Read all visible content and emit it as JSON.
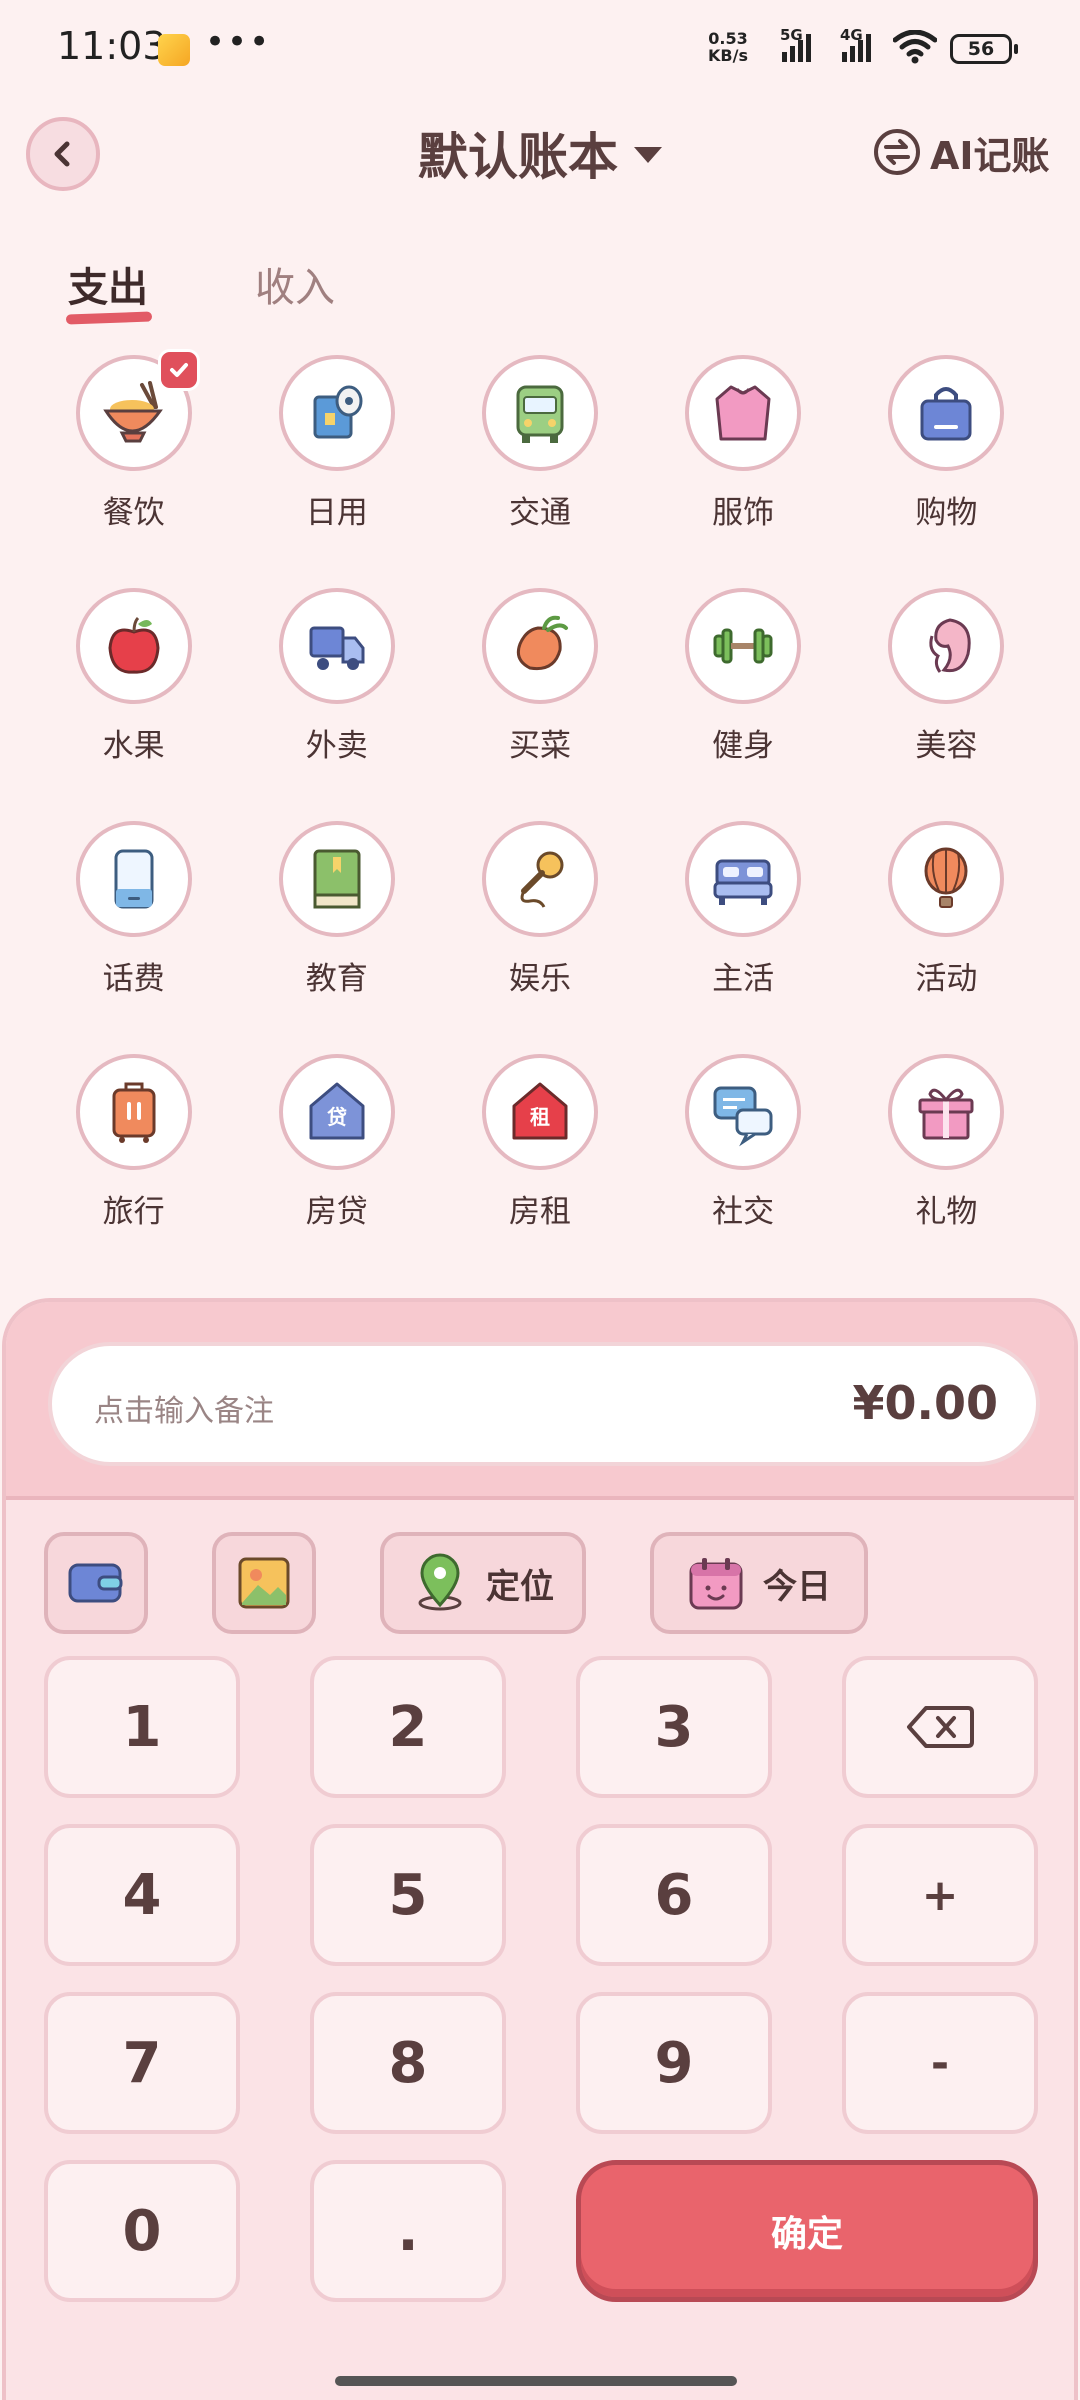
{
  "status_bar": {
    "time": "11:03",
    "dots": "•••",
    "speed_top": "0.53",
    "speed_bottom": "KB/s",
    "sig1": "5G",
    "sig2": "4G",
    "battery": "56"
  },
  "header": {
    "title": "默认账本",
    "ai_label": "AI记账"
  },
  "tabs": {
    "expense": "支出",
    "income": "收入"
  },
  "categories": [
    {
      "label": "餐饮",
      "icon": "food-bowl-icon"
    },
    {
      "label": "日用",
      "icon": "tissue-roll-icon"
    },
    {
      "label": "交通",
      "icon": "bus-icon"
    },
    {
      "label": "服饰",
      "icon": "sweater-icon"
    },
    {
      "label": "购物",
      "icon": "shopping-bag-icon"
    },
    {
      "label": "水果",
      "icon": "apple-icon"
    },
    {
      "label": "外卖",
      "icon": "delivery-truck-icon"
    },
    {
      "label": "买菜",
      "icon": "carrot-icon"
    },
    {
      "label": "健身",
      "icon": "dumbbell-icon"
    },
    {
      "label": "美容",
      "icon": "face-icon"
    },
    {
      "label": "话费",
      "icon": "phone-icon"
    },
    {
      "label": "教育",
      "icon": "book-icon"
    },
    {
      "label": "娱乐",
      "icon": "microphone-icon"
    },
    {
      "label": "主活",
      "icon": "bed-icon"
    },
    {
      "label": "活动",
      "icon": "balloon-icon"
    },
    {
      "label": "旅行",
      "icon": "luggage-icon"
    },
    {
      "label": "房贷",
      "icon": "house-loan-icon"
    },
    {
      "label": "房租",
      "icon": "house-rent-icon"
    },
    {
      "label": "社交",
      "icon": "chat-icon"
    },
    {
      "label": "礼物",
      "icon": "gift-icon"
    }
  ],
  "loan_char": "贷",
  "rent_char": "租",
  "entry": {
    "note_placeholder": "点击输入备注",
    "amount": "¥0.00"
  },
  "tools": {
    "location": "定位",
    "date": "今日"
  },
  "keys": {
    "k1": "1",
    "k2": "2",
    "k3": "3",
    "k4": "4",
    "k5": "5",
    "k6": "6",
    "k7": "7",
    "k8": "8",
    "k9": "9",
    "k0": "0",
    "dot": ".",
    "plus": "+",
    "minus": "-",
    "confirm": "确定"
  },
  "colors": {
    "accent": "#e9646c",
    "background": "#fdf1f1",
    "panel": "#fbe3e6"
  }
}
